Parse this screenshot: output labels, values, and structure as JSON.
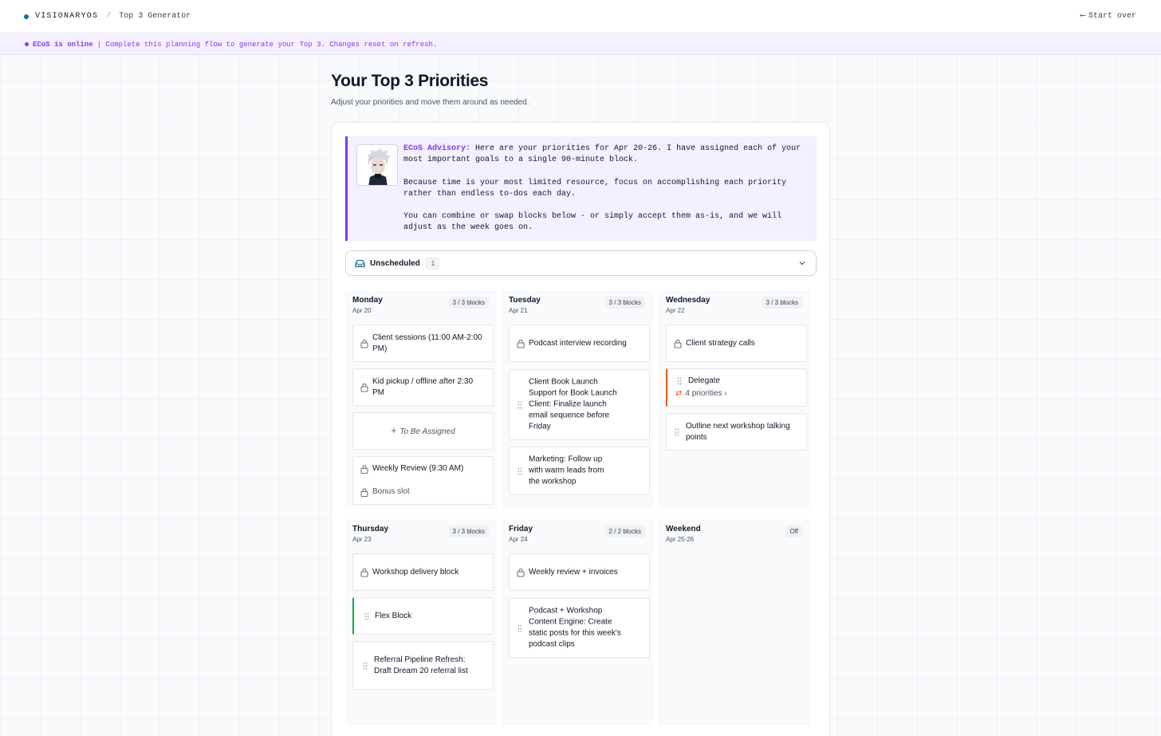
{
  "topbar": {
    "brand": "VISIONARYOS",
    "separator": "/",
    "crumb": "Top 3 Generator",
    "start_over": "Start over",
    "start_over_arrow": "⟵"
  },
  "status": {
    "online_label": "ECoS is online",
    "message": "| Complete this planning flow to generate your Top 3. Changes reset on refresh."
  },
  "header": {
    "title": "Your Top 3 Priorities",
    "subtitle": "Adjust your priorities and move them around as needed."
  },
  "advisory": {
    "label": "ECoS Advisory:",
    "line1": "Here are your priorities for Apr 20-26. I have assigned each of your most important goals to a single 90-minute block.",
    "line2": "Because time is your most limited resource, focus on accomplishing each priority rather than endless to-dos each day.",
    "line3": "You can combine or swap blocks below - or simply accept them as-is, and we will adjust as the week goes on."
  },
  "unscheduled": {
    "label": "Unscheduled",
    "count": "1"
  },
  "days": {
    "mon": {
      "name": "Monday",
      "date": "Apr 20",
      "badge": "3 / 3 blocks",
      "b1": "Client sessions (11:00 AM-2:00 PM)",
      "b2": "Kid pickup / offline after 2:30 PM",
      "b3": "To Be Assigned",
      "b4": "Weekly Review (9:30 AM)",
      "b4_sub": "Bonus slot"
    },
    "tue": {
      "name": "Tuesday",
      "date": "Apr 21",
      "badge": "3 / 3 blocks",
      "b1": "Podcast interview recording",
      "b2": "Client Book Launch Support for Book Launch Client: Finalize launch email sequence before Friday",
      "b3": "Marketing: Follow up with warm leads from the workshop"
    },
    "wed": {
      "name": "Wednesday",
      "date": "Apr 22",
      "badge": "3 / 3 blocks",
      "b1": "Client strategy calls",
      "b2": "Delegate",
      "b2_sub": "4 priorities ›",
      "b3": "Outline next workshop talking points"
    },
    "thu": {
      "name": "Thursday",
      "date": "Apr 23",
      "badge": "3 / 3 blocks",
      "b1": "Workshop delivery block",
      "b2": "Flex Block",
      "b3": "Referral Pipeline Refresh: Draft Dream 20 referral list"
    },
    "fri": {
      "name": "Friday",
      "date": "Apr 24",
      "badge": "2 / 2 blocks",
      "b1": "Weekly review + invoices",
      "b2": "Podcast + Workshop Content Engine: Create static posts for this week's podcast clips"
    },
    "wkd": {
      "name": "Weekend",
      "date": "Apr 25-26",
      "badge": "Off"
    }
  },
  "colors": {
    "accent_purple": "#7c3aed",
    "accent_teal": "#0e7490",
    "delegate_orange": "#ea580c",
    "flex_green": "#16a34a"
  },
  "icons": [
    "lock-icon",
    "drag-handle-icon",
    "plus-icon",
    "swap-icon",
    "inbox-icon",
    "chevron-down-icon",
    "arrow-left-icon"
  ]
}
